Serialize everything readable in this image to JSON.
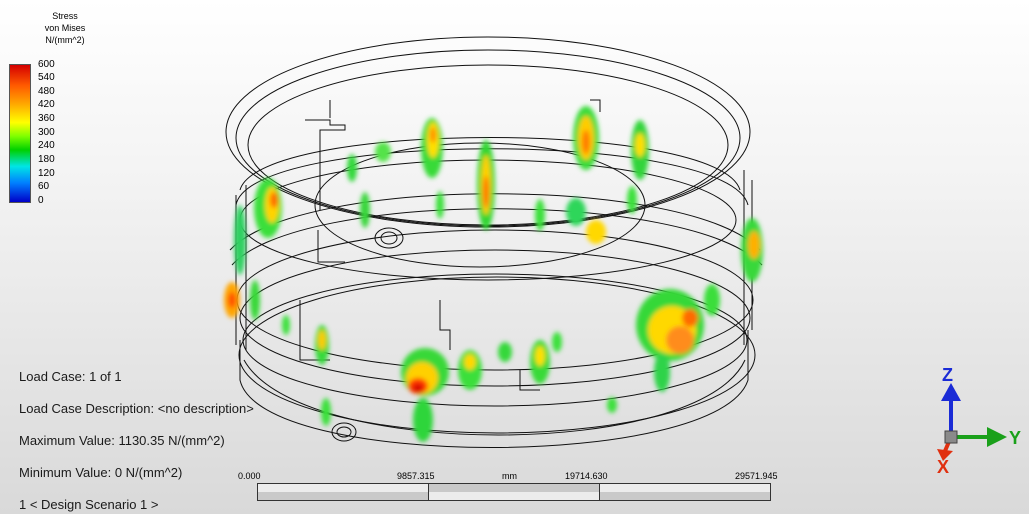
{
  "legend": {
    "title_lines": [
      "Stress",
      "von Mises",
      "N/(mm^2)"
    ],
    "ticks": [
      "600",
      "540",
      "480",
      "420",
      "360",
      "300",
      "240",
      "180",
      "120",
      "60",
      "0"
    ]
  },
  "info": {
    "load_case": "Load Case:  1 of 1",
    "load_case_description": "Load Case Description:  <no description>",
    "maximum_value": "Maximum Value: 1130.35 N/(mm^2)",
    "minimum_value": "Minimum Value: 0 N/(mm^2)",
    "design_scenario": "1 < Design Scenario 1 >"
  },
  "scale": {
    "labels": [
      "0.000",
      "9857.315",
      "mm",
      "19714.630",
      "29571.945"
    ]
  },
  "triad": {
    "z_label": "Z",
    "y_label": "Y",
    "x_label": "X"
  },
  "colors": {
    "high": "#d40000",
    "mid": "#ffff00",
    "low": "#0000c8",
    "axis_z": "#1a2bd6",
    "axis_y": "#1aa01a",
    "axis_x": "#e03010"
  }
}
